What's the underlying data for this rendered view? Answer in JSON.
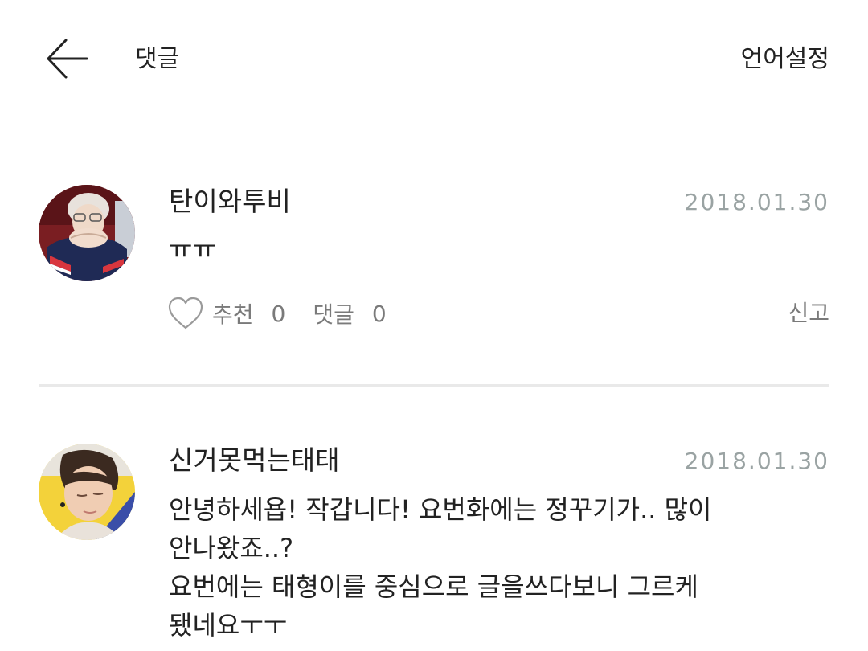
{
  "header": {
    "title": "댓글",
    "language_setting": "언어설정",
    "back_icon": "arrow-left-icon"
  },
  "comments": [
    {
      "author": "탄이와투비",
      "date": "2018.01.30",
      "lines": [
        "ㅠㅠ"
      ],
      "like_label": "추천",
      "like_count": "0",
      "reply_label": "댓글",
      "reply_count": "0",
      "report_label": "신고",
      "like_icon": "heart-icon"
    },
    {
      "author": "신거못먹는태태",
      "date": "2018.01.30",
      "lines": [
        "안녕하세욥! 작갑니다! 요번화에는 정꾸기가.. 많이",
        "안나왔죠..?",
        "요번에는 태형이를 중심으로 글을쓰다보니 그르케",
        "됐네요ㅜㅜ"
      ]
    }
  ],
  "colors": {
    "text": "#222222",
    "date": "#9aa3a3",
    "action": "#7a7a7a",
    "divider": "#e9e9e9"
  }
}
